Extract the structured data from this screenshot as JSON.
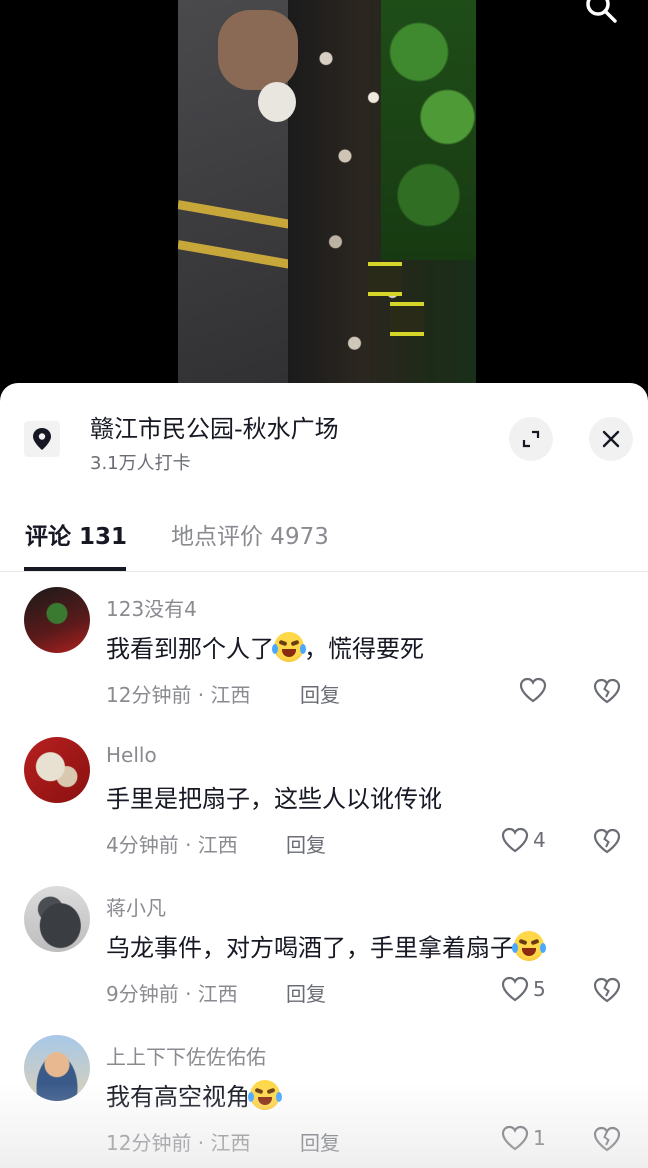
{
  "location": {
    "name": "赣江市民公园-秋水广场",
    "checkins": "3.1万人打卡"
  },
  "tabs": {
    "comments_label": "评论 131",
    "reviews_label": "地点评价 4973"
  },
  "comments": [
    {
      "user": "123没有4",
      "text_a": "我看到那个人了",
      "emoji": "crying-laughing",
      "text_b": "，慌得要死",
      "meta": "12分钟前 · 江西",
      "reply": "回复",
      "likes": ""
    },
    {
      "user": "Hello",
      "text_a": "手里是把扇子，这些人以讹传讹",
      "emoji": "",
      "text_b": "",
      "meta": "4分钟前 · 江西",
      "reply": "回复",
      "likes": "4"
    },
    {
      "user": "蒋小凡",
      "text_a": "乌龙事件，对方喝酒了，手里拿着扇子",
      "emoji": "crying-laughing",
      "text_b": "",
      "meta": "9分钟前 · 江西",
      "reply": "回复",
      "likes": "5"
    },
    {
      "user": "上上下下佐佐佑佑",
      "text_a": "我有高空视角",
      "emoji": "crying-laughing",
      "text_b": "",
      "meta": "12分钟前 · 江西",
      "reply": "回复",
      "likes": "1"
    }
  ],
  "colors": {
    "accent_text": "#161823",
    "secondary_text": "#8a8b91",
    "panel_bg": "#ffffff"
  }
}
